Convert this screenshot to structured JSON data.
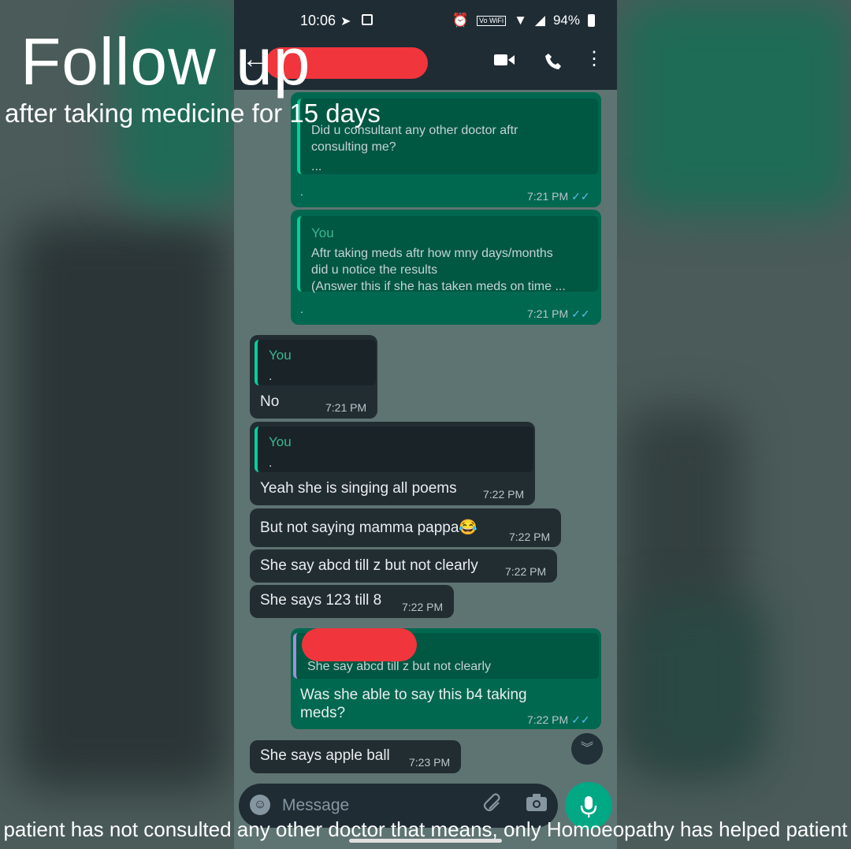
{
  "overlay": {
    "title": "Follow up",
    "subtitle": "after taking medicine for 15 days",
    "footer": "patient has not consulted any other doctor that means, only Homoeopathy has helped patient"
  },
  "status_bar": {
    "time": "10:06",
    "battery": "94%",
    "icons": [
      "telegram-send-icon",
      "image-icon",
      "alarm-icon",
      "vowifi-icon",
      "wifi-icon",
      "signal-icon",
      "battery-icon"
    ],
    "vowifi_label": "Vo WiFi"
  },
  "app_bar": {
    "icons": [
      "back-arrow-icon",
      "video-call-icon",
      "phone-icon",
      "more-vert-icon"
    ]
  },
  "messages": [
    {
      "dir": "out",
      "quote_text": "Did u consultant any other doctor aftr consulting me?",
      "quote_ellipsis": "...",
      "body": ".",
      "time": "7:21 PM"
    },
    {
      "dir": "out",
      "quote_name": "You",
      "quote_text_1": "Aftr taking meds aftr how mny days/months",
      "quote_text_2": "did u notice the results",
      "quote_text_3": "(Answer this if she has taken meds on time ...",
      "body": ".",
      "time": "7:21 PM"
    },
    {
      "dir": "in",
      "quote_name": "You",
      "quote_text": ".",
      "body": "No",
      "time": "7:21 PM"
    },
    {
      "dir": "in",
      "quote_name": "You",
      "quote_text": ".",
      "body": "Yeah she is singing all poems",
      "time": "7:22 PM"
    },
    {
      "dir": "in",
      "body": "But not saying mamma pappa😂",
      "time": "7:22 PM"
    },
    {
      "dir": "in",
      "body": "She say abcd till z but not clearly",
      "time": "7:22 PM"
    },
    {
      "dir": "in",
      "body": "She says 123 till 8",
      "time": "7:22 PM"
    },
    {
      "dir": "out",
      "quote_text": "She say abcd till z but not clearly",
      "body_1": "Was she able to say this b4  taking",
      "body_2": "meds?",
      "time": "7:22 PM"
    },
    {
      "dir": "in",
      "body": "She says apple ball",
      "time": "7:23 PM"
    }
  ],
  "composer": {
    "placeholder": "Message"
  },
  "colors": {
    "outgoing_bubble": "#00684f",
    "incoming_bubble": "#222d32",
    "header": "#1f2c34",
    "accent": "#00a884",
    "redaction": "#f0353d",
    "read_ticks": "#53bdeb"
  }
}
